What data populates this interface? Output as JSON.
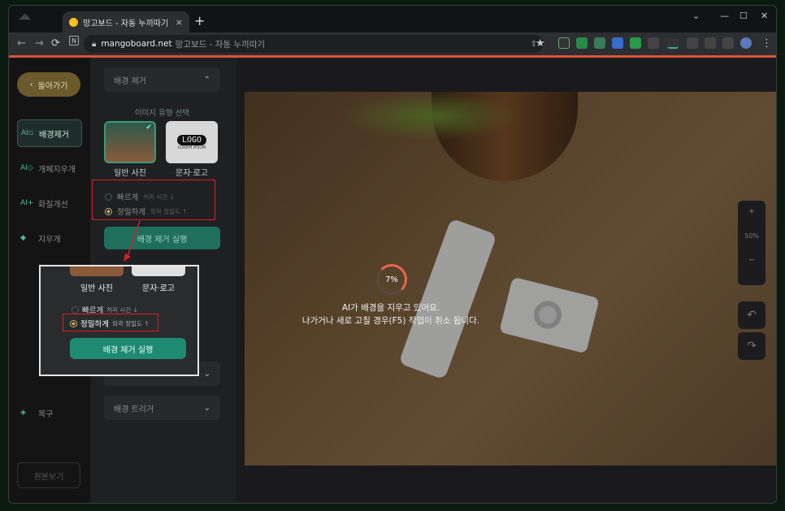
{
  "browser": {
    "tab_title": "망고보드 - 자동 누끼따기",
    "tab_close": "×",
    "new_tab": "+",
    "url_domain": "mangoboard.net",
    "url_rest": "망고보드 - 자동 누끼따기",
    "window_controls": [
      "⌄",
      "—",
      "☐",
      "✕"
    ],
    "progress": 1.0,
    "accent": "#d5553a"
  },
  "sidebar": {
    "back_label": "돌아가기",
    "items": [
      {
        "label": "배경제거",
        "icon": "ai-bg-remove-icon",
        "active": true
      },
      {
        "label": "개체지우개",
        "icon": "ai-object-eraser-icon",
        "active": false
      },
      {
        "label": "화질개선",
        "icon": "ai-upscale-icon",
        "active": false
      },
      {
        "label": "지우개",
        "icon": "eraser-icon",
        "active": false
      },
      {
        "label": "복구",
        "icon": "restore-icon",
        "active": false
      }
    ],
    "compare_label": "원본보기"
  },
  "panel": {
    "section_bg_remove": "배경 제거",
    "image_type_label": "이미지 유형 선택",
    "type_photo": "일반 사진",
    "type_logo": "문자·로고",
    "logo_text": "LOGO",
    "logo_sub": "LOREM IPSUM",
    "opt_fast": "빠르게",
    "opt_fast_hint": "처리 시간 ↓",
    "opt_precise": "정밀하게",
    "opt_precise_hint": "외곽 정밀도 ↑",
    "run_label": "배경 제거 실행",
    "section_bg_trim": "배경 트리거"
  },
  "canvas": {
    "progress_text": "7%",
    "progress_value": 0.07,
    "message_line1": "AI가 배경을 지우고 있어요.",
    "message_line2": "나가거나 새로 고칠 경우(F5) 작업이 취소 됩니다.",
    "zoom_in": "+",
    "zoom_level": "50%",
    "zoom_out": "−",
    "undo": "↶",
    "redo": "↷"
  }
}
